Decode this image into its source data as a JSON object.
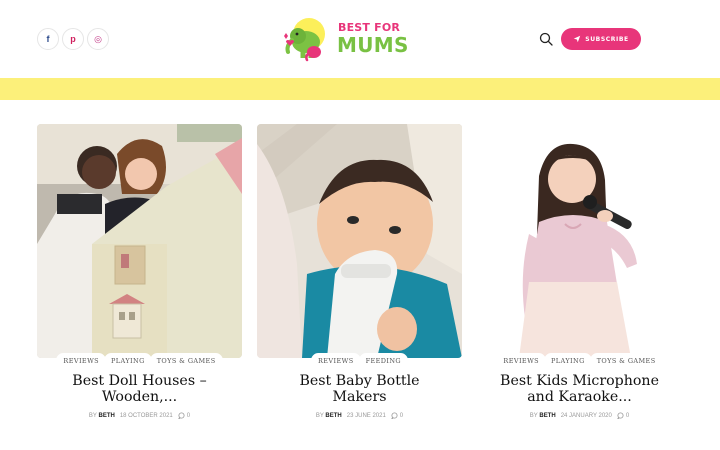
{
  "header": {
    "social": [
      {
        "icon": "facebook-icon",
        "glyph": "f"
      },
      {
        "icon": "pinterest-icon",
        "glyph": "p"
      },
      {
        "icon": "instagram-icon",
        "glyph": "◎"
      }
    ],
    "logo": {
      "line1": "BEST FOR",
      "line2": "MUMS"
    },
    "subscribe_label": "SUBSCRIBE"
  },
  "colors": {
    "accent": "#e8357a",
    "band": "#fcf07a",
    "logo_green": "#79c143"
  },
  "posts": [
    {
      "tags": [
        "REVIEWS",
        "PLAYING",
        "TOYS & GAMES"
      ],
      "title_line1": "Best Doll Houses –",
      "title_line2": "Wooden,...",
      "by": "BY",
      "author": "BETH",
      "date": "18 OCTOBER 2021",
      "comments": "0"
    },
    {
      "tags": [
        "REVIEWS",
        "FEEDING"
      ],
      "title_line1": "Best Baby Bottle",
      "title_line2": "Makers",
      "by": "BY",
      "author": "BETH",
      "date": "23 JUNE 2021",
      "comments": "0"
    },
    {
      "tags": [
        "REVIEWS",
        "PLAYING",
        "TOYS & GAMES"
      ],
      "title_line1": "Best Kids Microphone",
      "title_line2": "and Karaoke...",
      "by": "BY",
      "author": "BETH",
      "date": "24 JANUARY 2020",
      "comments": "0"
    }
  ]
}
